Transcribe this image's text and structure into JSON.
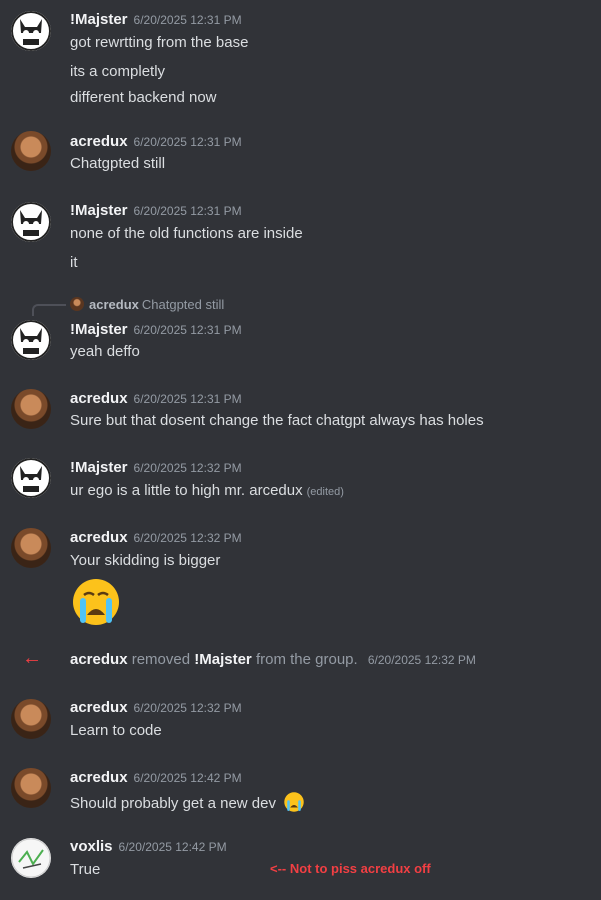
{
  "messages": [
    {
      "author": "!Majster",
      "time": "6/20/2025 12:31 PM",
      "lines": [
        "got rewrtting from the base",
        "its a completly",
        "different backend now"
      ]
    },
    {
      "author": "acredux",
      "time": "6/20/2025 12:31 PM",
      "lines": [
        "Chatgpted still"
      ]
    },
    {
      "author": "!Majster",
      "time": "6/20/2025 12:31 PM",
      "lines": [
        "none of the old functions are inside",
        "it"
      ]
    },
    {
      "author": "!Majster",
      "time": "6/20/2025 12:31 PM",
      "reply": {
        "author": "acredux",
        "text": "Chatgpted still"
      },
      "lines": [
        "yeah deffo"
      ]
    },
    {
      "author": "acredux",
      "time": "6/20/2025 12:31 PM",
      "lines": [
        "Sure but that dosent change the fact chatgpt always has holes"
      ]
    },
    {
      "author": "!Majster",
      "time": "6/20/2025 12:32 PM",
      "lines": [
        "ur ego is a little to high mr. arcedux"
      ],
      "edited": "(edited)"
    },
    {
      "author": "acredux",
      "time": "6/20/2025 12:32 PM",
      "lines": [
        "Your skidding is bigger"
      ],
      "emoji": "crying-emoji"
    },
    {
      "author": "acredux",
      "time": "6/20/2025 12:32 PM",
      "lines": [
        "Learn to code"
      ]
    },
    {
      "author": "acredux",
      "time": "6/20/2025 12:42 PM",
      "lines": [
        "Should probably get a new dev"
      ],
      "inline_emoji": "crying-emoji"
    },
    {
      "author": "voxlis",
      "time": "6/20/2025 12:42 PM",
      "lines": [
        "True"
      ]
    }
  ],
  "system": {
    "actor": "acredux",
    "action": "removed",
    "target": "!Majster",
    "suffix": "from the group.",
    "time": "6/20/2025 12:32 PM",
    "icon": "arrow-left-icon"
  },
  "annotation": "<-- Not to piss acredux off",
  "colors": {
    "background": "#313338",
    "system_arrow": "#f23f43",
    "annotation": "#f23f43"
  }
}
